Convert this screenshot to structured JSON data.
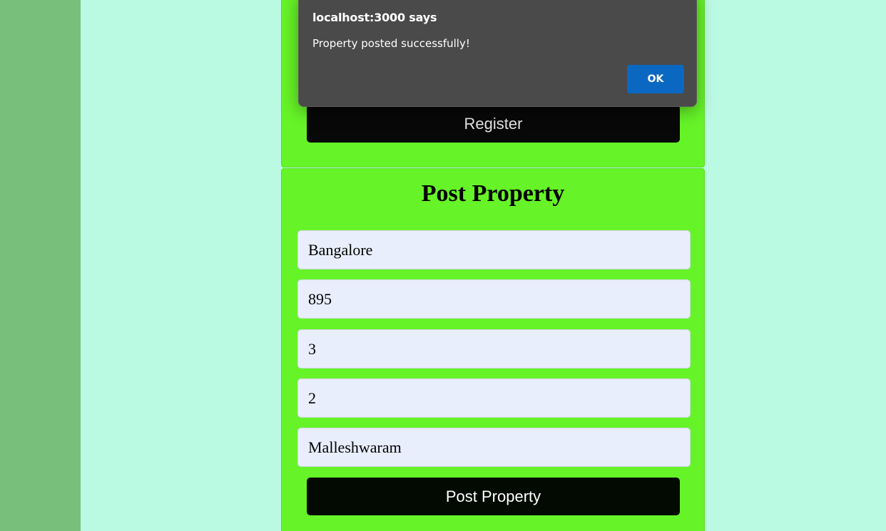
{
  "register_section": {
    "register_label": "Register"
  },
  "post_property": {
    "title": "Post Property",
    "fields": [
      {
        "value": "Bangalore"
      },
      {
        "value": "895"
      },
      {
        "value": "3"
      },
      {
        "value": "2"
      },
      {
        "value": "Malleshwaram"
      }
    ],
    "submit_label": "Post Property"
  },
  "alert": {
    "title": "localhost:3000 says",
    "message": "Property posted successfully!",
    "ok_label": "OK"
  },
  "colors": {
    "page_background": "#baf9e2",
    "left_strip": "#77bf7b",
    "card_background": "#66f428",
    "field_background": "#e8eefc",
    "button_dark": "#080808",
    "dialog_background": "#4a4a4a",
    "dialog_ok": "#0b68c2"
  }
}
